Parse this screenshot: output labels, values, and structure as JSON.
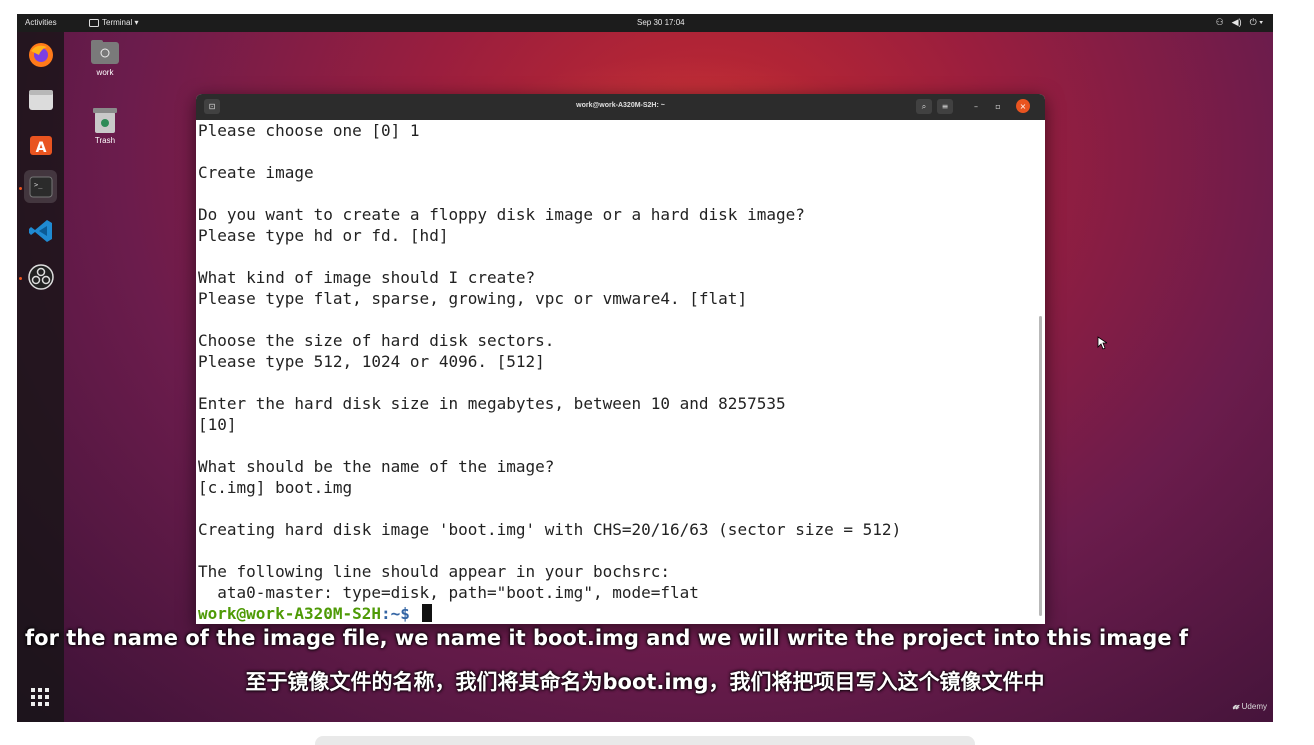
{
  "topbar": {
    "activities": "Activities",
    "app_label": "Terminal ▾",
    "clock": "Sep 30  17:04"
  },
  "desktop": {
    "home_label": "work",
    "trash_label": "Trash"
  },
  "terminal": {
    "title": "work@work-A320M-S2H: ~",
    "lines": [
      "Please choose one [0] 1",
      "",
      "Create image",
      "",
      "Do you want to create a floppy disk image or a hard disk image?",
      "Please type hd or fd. [hd]",
      "",
      "What kind of image should I create?",
      "Please type flat, sparse, growing, vpc or vmware4. [flat]",
      "",
      "Choose the size of hard disk sectors.",
      "Please type 512, 1024 or 4096. [512]",
      "",
      "Enter the hard disk size in megabytes, between 10 and 8257535",
      "[10]",
      "",
      "What should be the name of the image?",
      "[c.img] boot.img",
      "",
      "Creating hard disk image 'boot.img' with CHS=20/16/63 (sector size = 512)",
      "",
      "The following line should appear in your bochsrc:",
      "  ata0-master: type=disk, path=\"boot.img\", mode=flat"
    ],
    "prompt_user": "work@work-A320M-S2H",
    "prompt_path": ":~$"
  },
  "subtitles": {
    "english": "for the name of the image file, we name it boot.img and we will write the project into this image f",
    "chinese": "至于镜像文件的名称，我们将其命名为boot.img，我们将把项目写入这个镜像文件中"
  },
  "watermark": "Udemy",
  "colors": {
    "accent": "#e95420",
    "prompt_user": "#4e9a06",
    "prompt_path": "#3465a4"
  }
}
